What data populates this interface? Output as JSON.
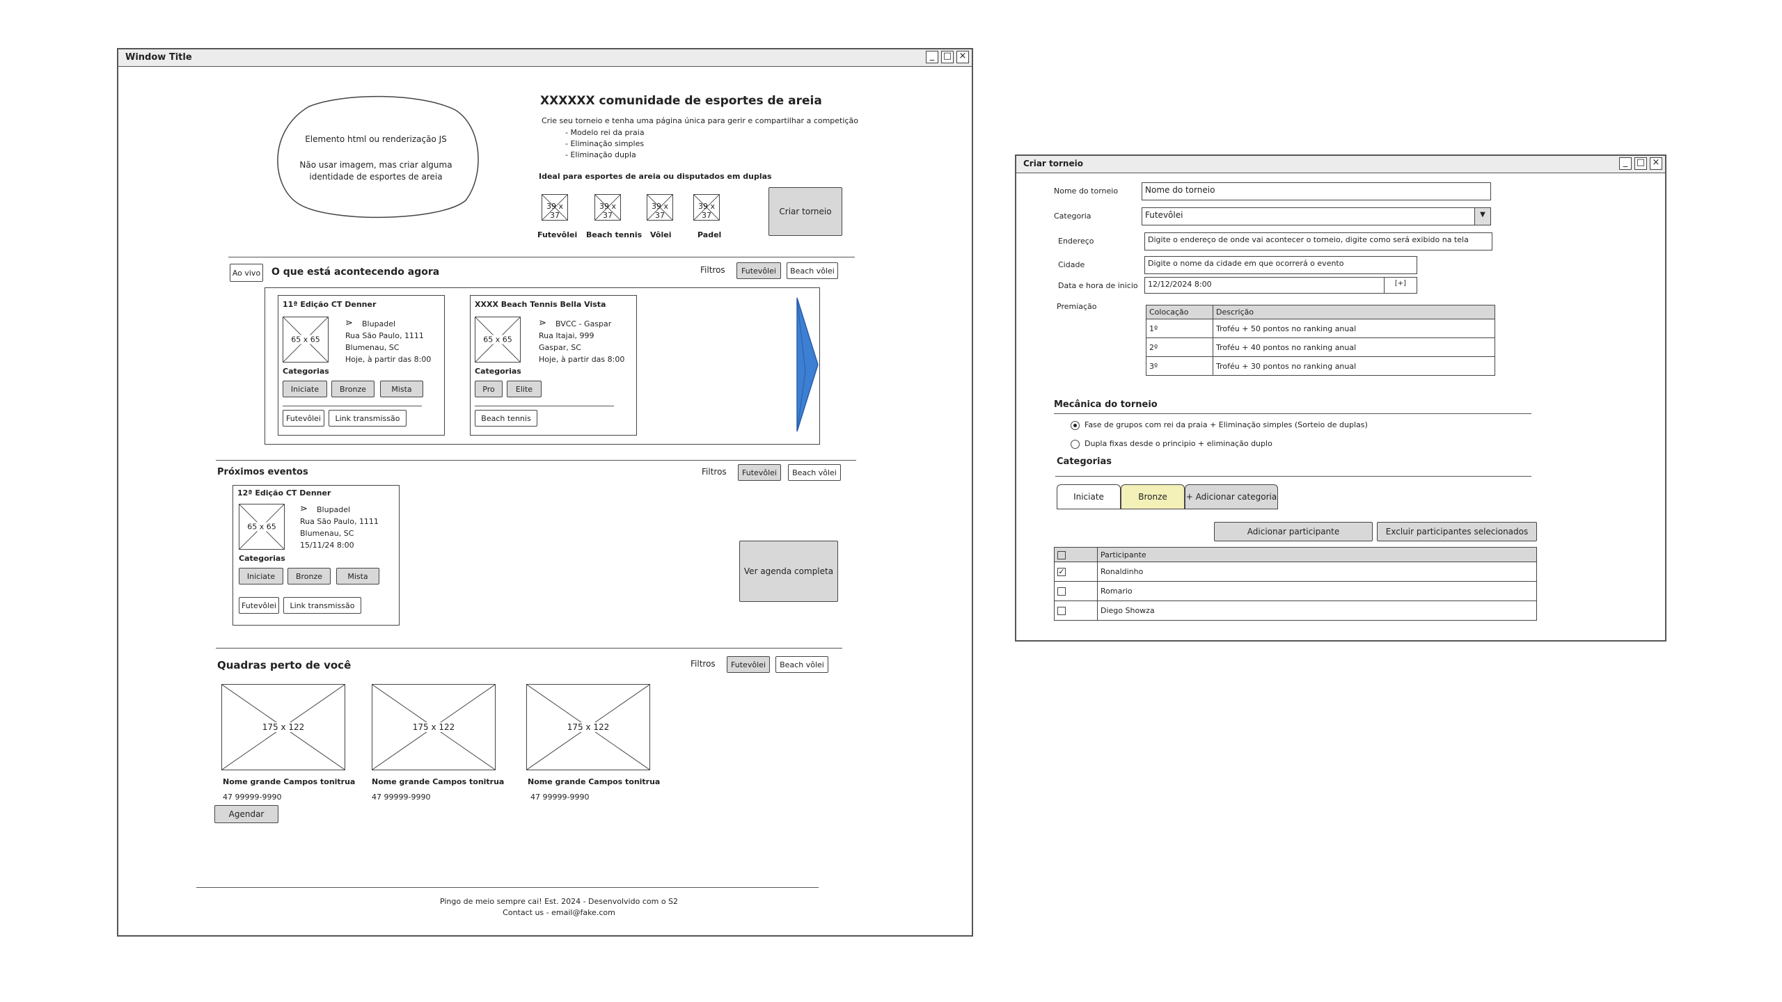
{
  "main_window": {
    "title": "Window Title",
    "hero": {
      "blob_line1": "Elemento html ou renderização JS",
      "blob_line2": "Não usar imagem, mas criar alguma identidade de esportes de areia",
      "title": "XXXXXX comunidade de esportes de areia",
      "desc": "Crie seu torneio e tenha uma página única para gerir e compartilhar a competição",
      "bullets": [
        "- Modelo rei da praia",
        "- Eliminação simples",
        "- Eliminação dupla"
      ],
      "ideal": "Ideal para esportes de areia ou disputados em duplas",
      "sports": [
        {
          "icon_label": "39 x 37",
          "label": "Futevôlei"
        },
        {
          "icon_label": "39 x 37",
          "label": "Beach tennis"
        },
        {
          "icon_label": "39 x 37",
          "label": "Vôlei"
        },
        {
          "icon_label": "39 x 37",
          "label": "Padel"
        }
      ],
      "create_button": "Criar torneio"
    },
    "live": {
      "badge": "Ao vivo",
      "title": "O que está acontecendo agora",
      "filters_label": "Filtros",
      "filters": [
        "Futevôlei",
        "Beach vôlei"
      ],
      "cards": [
        {
          "title": "11ª Edição CT Denner",
          "image_label": "65 x 65",
          "venue": "Blupadel",
          "address": "Rua São Paulo, 1111",
          "city": "Blumenau, SC",
          "when": "Hoje, à partir das 8:00",
          "categories_label": "Categorias",
          "categories": [
            "Iniciate",
            "Bronze",
            "Mista"
          ],
          "sport": "Futevôlei",
          "stream": "Link transmissão"
        },
        {
          "title": "XXXX Beach Tennis Bella Vista",
          "image_label": "65 x 65",
          "venue": "BVCC - Gaspar",
          "address": "Rua Itajai, 999",
          "city": "Gaspar, SC",
          "when": "Hoje, à partir das 8:00",
          "categories_label": "Categorias",
          "categories": [
            "Pro",
            "Elite"
          ],
          "sport": "Beach tennis"
        }
      ]
    },
    "upcoming": {
      "title": "Próximos eventos",
      "filters_label": "Filtros",
      "filters": [
        "Futevôlei",
        "Beach vôlei"
      ],
      "card": {
        "title": "12ª Edição CT Denner",
        "image_label": "65 x 65",
        "venue": "Blupadel",
        "address": "Rua São Paulo, 1111",
        "city": "Blumenau, SC",
        "when": "15/11/24 8:00",
        "categories_label": "Categorias",
        "categories": [
          "Iniciate",
          "Bronze",
          "Mista"
        ],
        "sport": "Futevôlei",
        "stream": "Link transmissão"
      },
      "full_agenda_button": "Ver agenda completa"
    },
    "courts": {
      "title": "Quadras perto de você",
      "filters_label": "Filtros",
      "filters": [
        "Futevôlei",
        "Beach vôlei"
      ],
      "items": [
        {
          "image_label": "175 x 122",
          "name": "Nome grande Campos tonitrua",
          "phone": "47 99999-9990"
        },
        {
          "image_label": "175 x 122",
          "name": "Nome grande Campos tonitrua",
          "phone": "47 99999-9990"
        },
        {
          "image_label": "175 x 122",
          "name": "Nome grande Campos tonitrua",
          "phone": "47 99999-9990"
        }
      ],
      "schedule_button": "Agendar"
    },
    "footer": {
      "line1": "Pingo de meio sempre cai! Est. 2024 - Desenvolvido com o S2",
      "line2": "Contact us - email@fake.com"
    }
  },
  "form_window": {
    "title": "Criar torneio",
    "fields": {
      "name_label": "Nome do torneio",
      "name_placeholder": "Nome do torneio",
      "category_label": "Categoria",
      "category_value": "Futevôlei",
      "address_label": "Endereço",
      "address_placeholder": "Digite o endereço de onde vai acontecer o torneio, digite como será exibido na tela",
      "city_label": "Cidade",
      "city_placeholder": "Digite o nome da cidade em que ocorrerá o evento",
      "date_label": "Data e hora de inicio",
      "date_value": "12/12/2024 8:00",
      "date_button": "[+]",
      "prize_label": "Premiação"
    },
    "prize_table": {
      "headers": [
        "Colocação",
        "Descrição"
      ],
      "rows": [
        [
          "1º",
          "Troféu + 50 pontos no ranking anual"
        ],
        [
          "2º",
          "Troféu + 40 pontos no ranking anual"
        ],
        [
          "3º",
          "Troféu + 30 pontos no ranking anual"
        ]
      ]
    },
    "mechanics": {
      "title": "Mecânica do torneio",
      "options": [
        {
          "label": "Fase de grupos com rei da praia + Eliminação simples (Sorteio de duplas)",
          "selected": true
        },
        {
          "label": "Dupla fixas desde o principio + eliminação duplo",
          "selected": false
        }
      ]
    },
    "categories": {
      "title": "Categorias",
      "tabs": [
        "Iniciate",
        "Bronze"
      ],
      "add_tab": "+ Adicionar categoria",
      "add_participant": "Adicionar participante",
      "remove_selected": "Excluir participantes selecionados",
      "participants_header": "Participante",
      "participants": [
        {
          "name": "Ronaldinho",
          "checked": true
        },
        {
          "name": "Romario",
          "checked": false
        },
        {
          "name": "Diego Showza",
          "checked": false
        }
      ]
    }
  },
  "colors": {
    "arrow": "#3d7fd3",
    "button_gray": "#d8d8d8",
    "tab_active": "#f3f0b8"
  }
}
